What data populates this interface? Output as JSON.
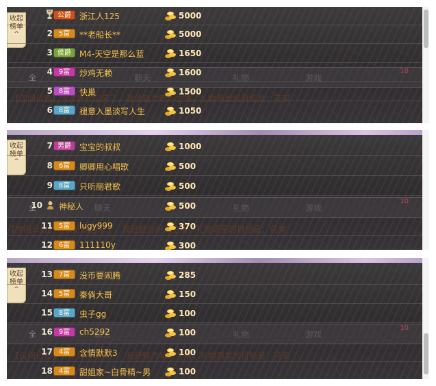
{
  "collapse_label": {
    "line1": "收起",
    "line2": "榜单",
    "arrow": "^"
  },
  "hint": {
    "all_label": "全",
    "tabs": [
      "聊天",
      "礼物",
      "游戏"
    ],
    "count": "10",
    "bleed_text": "【房间公告】大家好欢迎来了，我是魅力新人主播，礼物周星的目标是：花束"
  },
  "colors": {
    "name": "#f5c04c",
    "amount": "#ffe9b8",
    "rank": "#f0ead6"
  },
  "panels": [
    {
      "rows": [
        {
          "rank": "",
          "rank_icon": "trophy-icon",
          "badge": "公爵",
          "badge_color": "#c9521e",
          "name": "浙江人125",
          "amount": "5000"
        },
        {
          "rank": "2",
          "badge": "5富",
          "badge_color": "#d6891c",
          "name": "**老船长**",
          "amount": "5000"
        },
        {
          "rank": "3",
          "badge": "侯爵",
          "badge_color": "#77a33a",
          "name": "M4-天空是那么蓝",
          "amount": "1650"
        },
        {
          "rank": "4",
          "badge": "9富",
          "badge_color": "#c23aa7",
          "name": "炒鸡无赖",
          "amount": "1600"
        },
        {
          "rank": "5",
          "badge": "8富",
          "badge_color": "#b94fc2",
          "name": "快巢",
          "amount": "1500"
        },
        {
          "rank": "6",
          "badge": "8富",
          "badge_color": "#5aa6c8",
          "name": "褪意入墨淡写人生",
          "amount": "1050"
        }
      ]
    },
    {
      "rows": [
        {
          "rank": "7",
          "badge": "男爵",
          "badge_color": "#bb3f9a",
          "name": "宝宝的叔叔",
          "amount": "1000"
        },
        {
          "rank": "8",
          "badge": "6富",
          "badge_color": "#d6891c",
          "name": "卿卿用心唱歌",
          "amount": "500"
        },
        {
          "rank": "9",
          "badge": "8富",
          "badge_color": "#5aa6c8",
          "name": "只听丽君歌",
          "amount": "500"
        },
        {
          "rank": "10",
          "rank_icon": "mystery-user-icon",
          "badge": "",
          "badge_color": "",
          "name": "神秘人",
          "amount": "500"
        },
        {
          "rank": "11",
          "badge": "5富",
          "badge_color": "#d6891c",
          "name": "lugy999",
          "amount": "370"
        },
        {
          "rank": "12",
          "badge": "6富",
          "badge_color": "#d6891c",
          "name": "111110y",
          "amount": "300"
        }
      ]
    },
    {
      "rows": [
        {
          "rank": "13",
          "badge": "7富",
          "badge_color": "#d6891c",
          "name": "没币要闹腾",
          "amount": "285"
        },
        {
          "rank": "14",
          "badge": "5富",
          "badge_color": "#d6891c",
          "name": "秦倘大哥",
          "amount": "150"
        },
        {
          "rank": "15",
          "badge": "8富",
          "badge_color": "#5aa6c8",
          "name": "虫子gg",
          "amount": "100"
        },
        {
          "rank": "16",
          "badge": "9富",
          "badge_color": "#c23aa7",
          "name": "ch5292",
          "amount": "100"
        },
        {
          "rank": "17",
          "badge": "4富",
          "badge_color": "#d6891c",
          "name": "含情默默3",
          "amount": "100"
        },
        {
          "rank": "18",
          "badge": "4富",
          "badge_color": "#d6891c",
          "name": "甜姐家~白骨精~男",
          "amount": "100"
        }
      ]
    }
  ]
}
